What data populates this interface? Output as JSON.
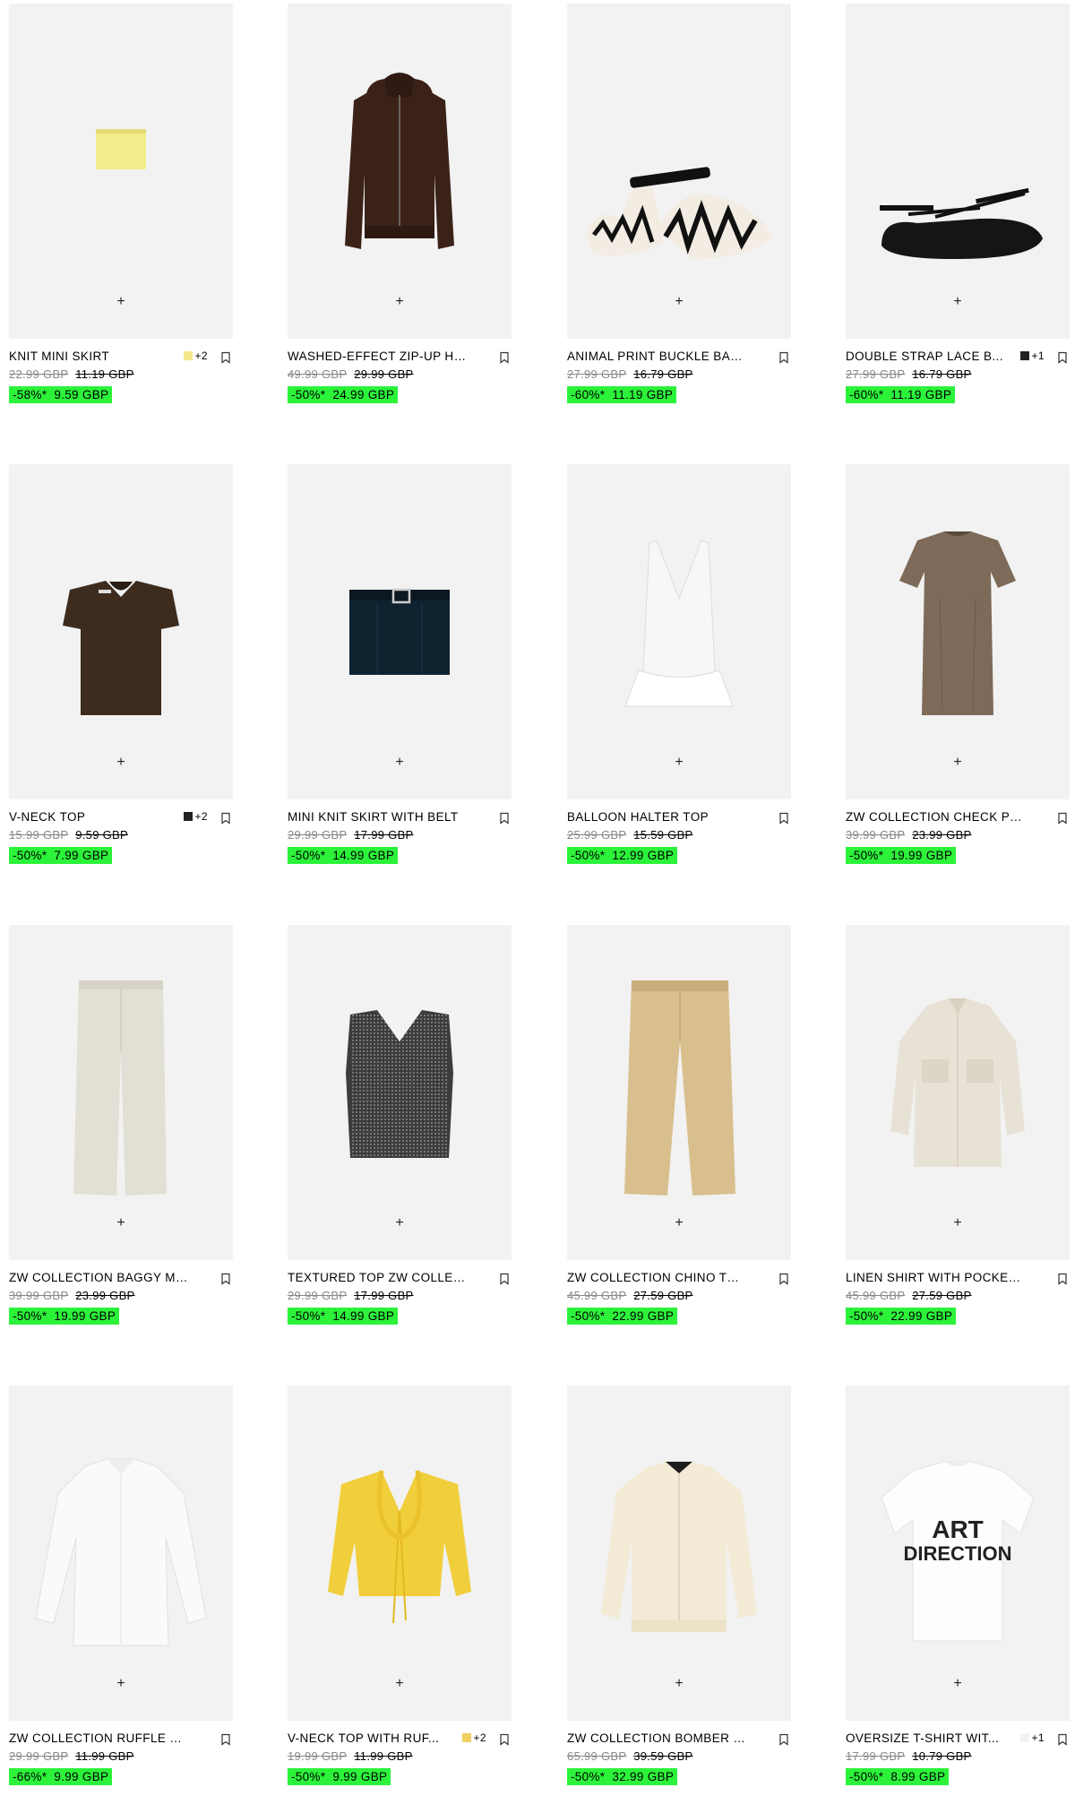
{
  "products": [
    {
      "name": "KNIT MINI SKIRT",
      "swatch_color": "#f5e88a",
      "swatch_more": "+2",
      "orig": "22.99 GBP",
      "prev": "11.19 GBP",
      "discount": "-58%*",
      "price": "9.59 GBP",
      "icon": "knit-mini-skirt-image"
    },
    {
      "name": "WASHED-EFFECT ZIP-UP HO...",
      "swatch_color": "",
      "swatch_more": "",
      "orig": "49.99 GBP",
      "prev": "29.99 GBP",
      "discount": "-50%*",
      "price": "24.99 GBP",
      "icon": "zip-up-hoodie-image"
    },
    {
      "name": "ANIMAL PRINT BUCKLE BALL...",
      "swatch_color": "",
      "swatch_more": "",
      "orig": "27.99 GBP",
      "prev": "16.79 GBP",
      "discount": "-60%*",
      "price": "11.19 GBP",
      "icon": "zebra-ballet-flats-image"
    },
    {
      "name": "DOUBLE STRAP LACE B...",
      "swatch_color": "#222222",
      "swatch_more": "+1",
      "orig": "27.99 GBP",
      "prev": "16.79 GBP",
      "discount": "-60%*",
      "price": "11.19 GBP",
      "icon": "lace-ballet-flat-image"
    },
    {
      "name": "V-NECK TOP",
      "swatch_color": "#222222",
      "swatch_more": "+2",
      "orig": "15.99 GBP",
      "prev": "9.59 GBP",
      "discount": "-50%*",
      "price": "7.99 GBP",
      "icon": "v-neck-top-image"
    },
    {
      "name": "MINI KNIT SKIRT WITH BELT",
      "swatch_color": "",
      "swatch_more": "",
      "orig": "29.99 GBP",
      "prev": "17.99 GBP",
      "discount": "-50%*",
      "price": "14.99 GBP",
      "icon": "belted-mini-skirt-image"
    },
    {
      "name": "BALLOON HALTER TOP",
      "swatch_color": "",
      "swatch_more": "",
      "orig": "25.99 GBP",
      "prev": "15.59 GBP",
      "discount": "-50%*",
      "price": "12.99 GBP",
      "icon": "halter-top-image"
    },
    {
      "name": "ZW COLLECTION CHECK PLE...",
      "swatch_color": "",
      "swatch_more": "",
      "orig": "39.99 GBP",
      "prev": "23.99 GBP",
      "discount": "-50%*",
      "price": "19.99 GBP",
      "icon": "check-dress-image"
    },
    {
      "name": "ZW COLLECTION BAGGY MID...",
      "swatch_color": "",
      "swatch_more": "",
      "orig": "39.99 GBP",
      "prev": "23.99 GBP",
      "discount": "-50%*",
      "price": "19.99 GBP",
      "icon": "baggy-jeans-image"
    },
    {
      "name": "TEXTURED TOP ZW COLLECT...",
      "swatch_color": "",
      "swatch_more": "",
      "orig": "29.99 GBP",
      "prev": "17.99 GBP",
      "discount": "-50%*",
      "price": "14.99 GBP",
      "icon": "textured-vest-image"
    },
    {
      "name": "ZW COLLECTION CHINO TRO...",
      "swatch_color": "",
      "swatch_more": "",
      "orig": "45.99 GBP",
      "prev": "27.59 GBP",
      "discount": "-50%*",
      "price": "22.99 GBP",
      "icon": "chino-trousers-image"
    },
    {
      "name": "LINEN SHIRT WITH POCKETS...",
      "swatch_color": "",
      "swatch_more": "",
      "orig": "45.99 GBP",
      "prev": "27.59 GBP",
      "discount": "-50%*",
      "price": "22.99 GBP",
      "icon": "linen-shirt-image"
    },
    {
      "name": "ZW COLLECTION RUFFLE SHI...",
      "swatch_color": "",
      "swatch_more": "",
      "orig": "29.99 GBP",
      "prev": "11.99 GBP",
      "discount": "-66%*",
      "price": "9.99 GBP",
      "icon": "ruffle-shirt-image"
    },
    {
      "name": "V-NECK TOP WITH RUF...",
      "swatch_color": "#f0d060",
      "swatch_more": "+2",
      "orig": "19.99 GBP",
      "prev": "11.99 GBP",
      "discount": "-50%*",
      "price": "9.99 GBP",
      "icon": "yellow-ruffle-top-image"
    },
    {
      "name": "ZW COLLECTION BOMBER JA...",
      "swatch_color": "",
      "swatch_more": "",
      "orig": "65.99 GBP",
      "prev": "39.59 GBP",
      "discount": "-50%*",
      "price": "32.99 GBP",
      "icon": "bomber-jacket-image"
    },
    {
      "name": "OVERSIZE T-SHIRT WIT...",
      "swatch_color": "#f2f2f2",
      "swatch_more": "+1",
      "orig": "17.99 GBP",
      "prev": "10.79 GBP",
      "discount": "-50%*",
      "price": "8.99 GBP",
      "icon": "art-direction-tshirt-image",
      "print_text_1": "ART",
      "print_text_2": "DIRECTION"
    }
  ],
  "ui": {
    "plus": "+"
  }
}
